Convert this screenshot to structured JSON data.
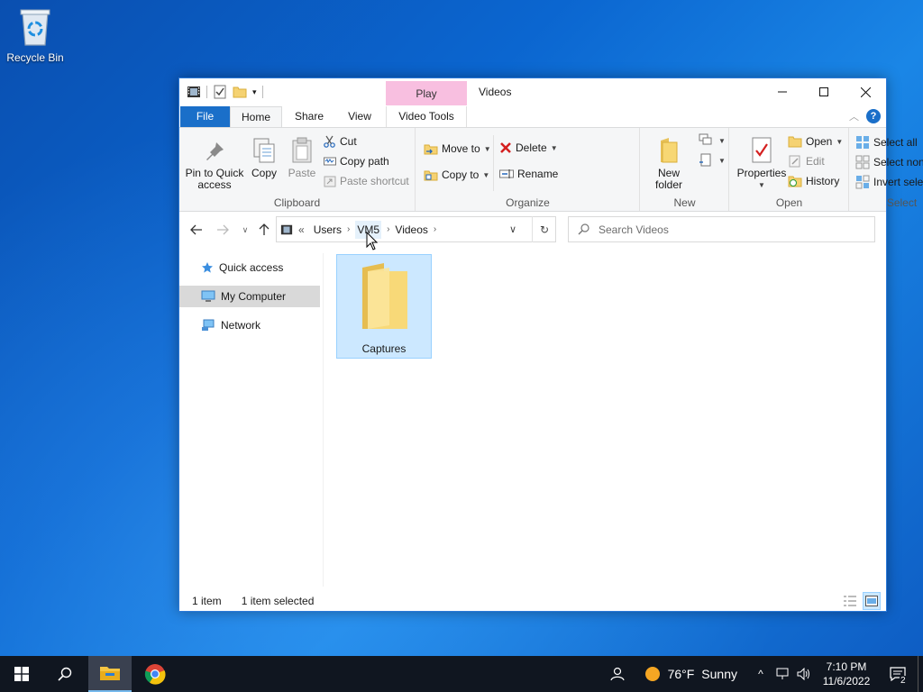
{
  "desktop": {
    "recycle_bin_label": "Recycle Bin"
  },
  "window": {
    "title": "Videos",
    "contextual_tab_group": "Play",
    "tabs": {
      "file": "File",
      "home": "Home",
      "share": "Share",
      "view": "View",
      "video_tools": "Video Tools"
    },
    "ribbon": {
      "clipboard": {
        "label": "Clipboard",
        "pin": "Pin to Quick access",
        "copy": "Copy",
        "paste": "Paste",
        "cut": "Cut",
        "copy_path": "Copy path",
        "paste_shortcut": "Paste shortcut"
      },
      "organize": {
        "label": "Organize",
        "move_to": "Move to",
        "copy_to": "Copy to",
        "delete": "Delete",
        "rename": "Rename"
      },
      "new": {
        "label": "New",
        "new_folder": "New folder"
      },
      "open": {
        "label": "Open",
        "properties": "Properties",
        "open": "Open",
        "edit": "Edit",
        "history": "History"
      },
      "select": {
        "label": "Select",
        "select_all": "Select all",
        "select_none": "Select none",
        "invert_selection": "Invert selection"
      }
    },
    "address": {
      "overflow": "«",
      "crumbs": [
        "Users",
        "VM5",
        "Videos"
      ]
    },
    "search": {
      "placeholder": "Search Videos"
    },
    "nav_pane": {
      "items": [
        "Quick access",
        "My Computer",
        "Network"
      ],
      "selected": "My Computer"
    },
    "content": {
      "items": [
        {
          "name": "Captures",
          "type": "folder",
          "selected": true
        }
      ]
    },
    "status": {
      "count": "1 item",
      "selection": "1 item selected"
    }
  },
  "taskbar": {
    "weather": {
      "temp": "76°F",
      "condition": "Sunny"
    },
    "clock": {
      "time": "7:10 PM",
      "date": "11/6/2022"
    },
    "notification_count": "2"
  },
  "colors": {
    "accent": "#1a6fc9",
    "selection": "#cce8ff",
    "contextual_tab": "#f8bfe0",
    "folder": "#f5d272"
  }
}
